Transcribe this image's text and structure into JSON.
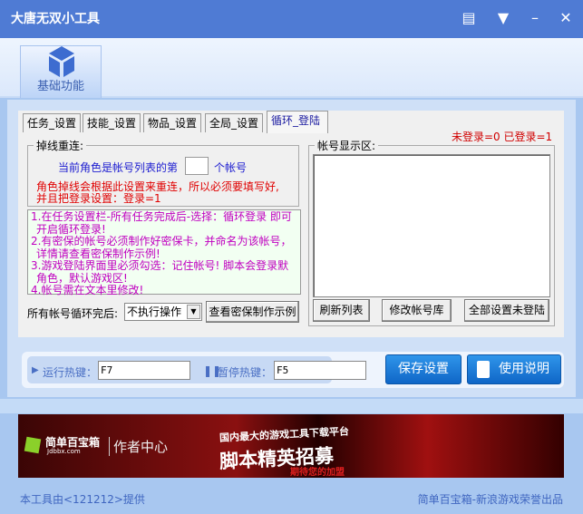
{
  "window": {
    "title": "大唐无双小工具"
  },
  "toolbar": {
    "basic_label": "基础功能"
  },
  "tabs": [
    {
      "label": "任务_设置"
    },
    {
      "label": "技能_设置"
    },
    {
      "label": "物品_设置"
    },
    {
      "label": "全局_设置"
    },
    {
      "label": "循环_登陆"
    }
  ],
  "status": "未登录=0 已登录=1",
  "reconnect": {
    "group_label": "掉线重连:",
    "prefix": "当前角色是帐号列表的第",
    "value": "",
    "suffix": "个帐号",
    "warning1": "角色掉线会根据此设置来重连，所以必须要填写好,",
    "warning2": "并且把登录设置：登录=1"
  },
  "notes": [
    "1.在任务设置栏-所有任务完成后-选择：循环登录 即可",
    "开启循环登录!",
    "2.有密保的帐号必须制作好密保卡，并命名为该帐号，",
    "详情请查看密保制作示例!",
    "3.游戏登陆界面里必须勾选：记住帐号! 脚本会登录默",
    "角色，默认游戏区!",
    "4.帐号需在文本里修改!"
  ],
  "loop": {
    "label": "所有帐号循环完后:",
    "select_value": "不执行操作",
    "example_button": "查看密保制作示例"
  },
  "accounts": {
    "group_label": "帐号显示区:",
    "refresh": "刷新列表",
    "edit": "修改帐号库",
    "reset": "全部设置未登陆"
  },
  "hotkeys": {
    "run_label": "运行热键：",
    "run_value": "F7",
    "pause_label": "暂停热键：",
    "pause_value": "F5",
    "save": "保存设置",
    "help": "使用说明"
  },
  "banner": {
    "brand": "简单百宝箱",
    "site": "Jdbbx.com",
    "center": "作者中心",
    "line1": "国内最大的游戏工具下载平台",
    "line2": "脚本精英招募",
    "line3": "期待您的加盟"
  },
  "footer": {
    "left": "本工具由<121212>提供",
    "right": "简单百宝箱-新浪游戏荣誉出品"
  }
}
